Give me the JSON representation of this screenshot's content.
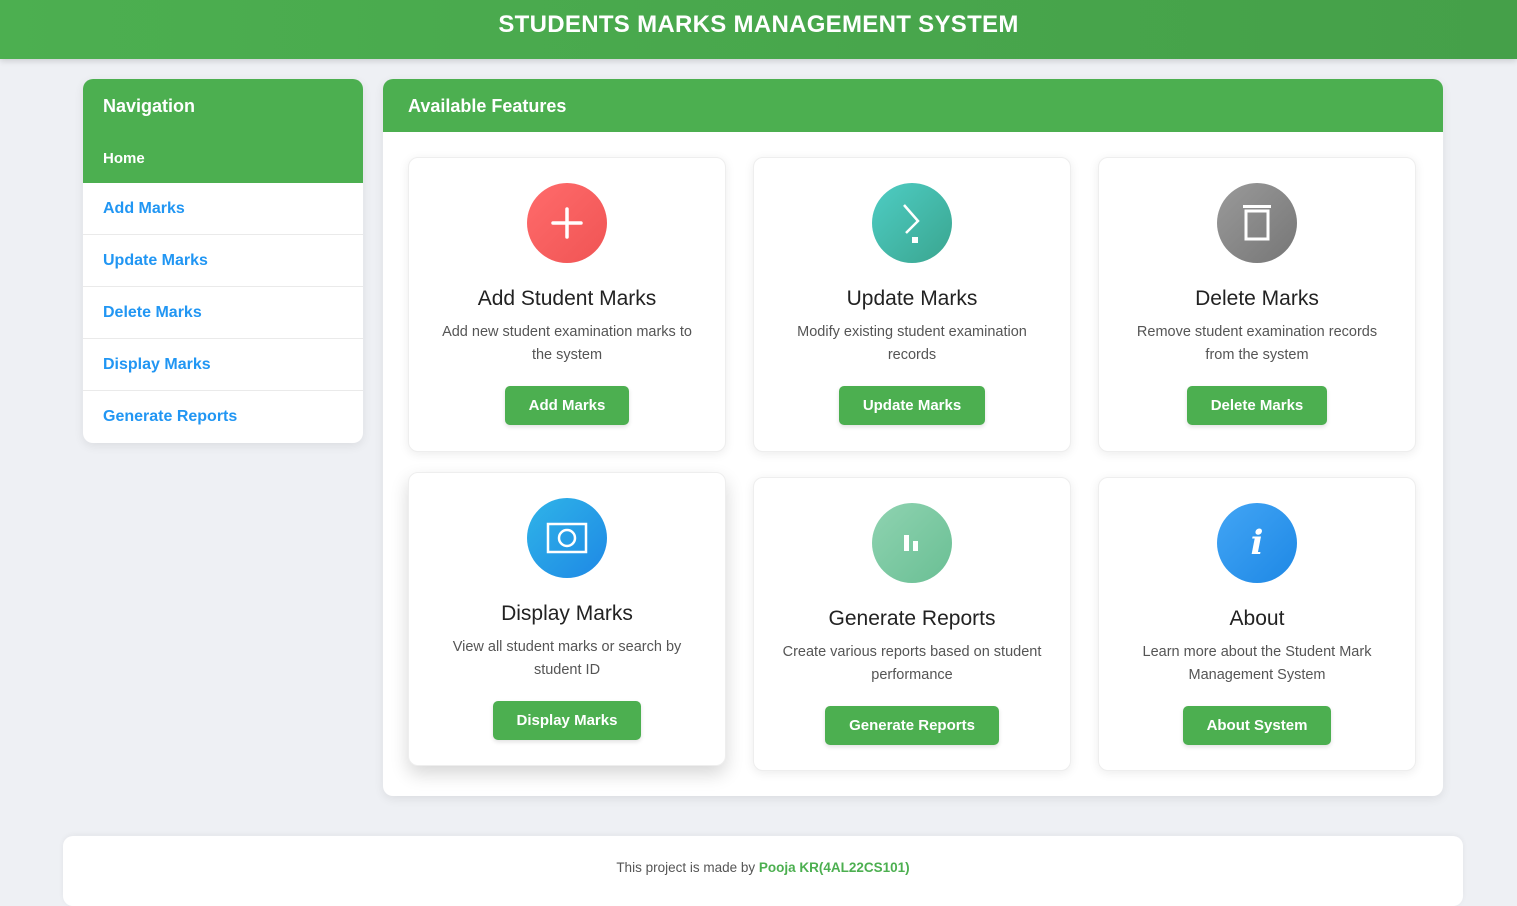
{
  "header": {
    "title": "STUDENTS MARKS MANAGEMENT SYSTEM"
  },
  "sidebar": {
    "title": "Navigation",
    "items": [
      {
        "label": "Home",
        "active": true
      },
      {
        "label": "Add Marks"
      },
      {
        "label": "Update Marks"
      },
      {
        "label": "Delete Marks"
      },
      {
        "label": "Display Marks"
      },
      {
        "label": "Generate Reports"
      }
    ]
  },
  "main": {
    "title": "Available Features",
    "cards": [
      {
        "icon": "plus-icon",
        "title": "Add Student Marks",
        "desc": "Add new student examination marks to the system",
        "button": "Add Marks",
        "color": "#ff6b6b"
      },
      {
        "icon": "chevron-right-icon",
        "title": "Update Marks",
        "desc": "Modify existing student examination records",
        "button": "Update Marks",
        "color": "#3dbdac"
      },
      {
        "icon": "trash-icon",
        "title": "Delete Marks",
        "desc": "Remove student examination records from the system",
        "button": "Delete Marks",
        "color": "#8a8a8a"
      },
      {
        "icon": "display-icon",
        "title": "Display Marks",
        "desc": "View all student marks or search by student ID",
        "button": "Display Marks",
        "color": "#2a9fe0"
      },
      {
        "icon": "bar-chart-icon",
        "title": "Generate Reports",
        "desc": "Create various reports based on student performance",
        "button": "Generate Reports",
        "color": "#7ec9a4"
      },
      {
        "icon": "info-icon",
        "title": "About",
        "desc": "Learn more about the Student Mark Management System",
        "button": "About System",
        "color": "#2196f3"
      }
    ]
  },
  "footer": {
    "prefix": "This project is made by ",
    "author": "Pooja KR(4AL22CS101)"
  },
  "colors": {
    "primary": "#4caf50",
    "link": "#2196f3"
  }
}
